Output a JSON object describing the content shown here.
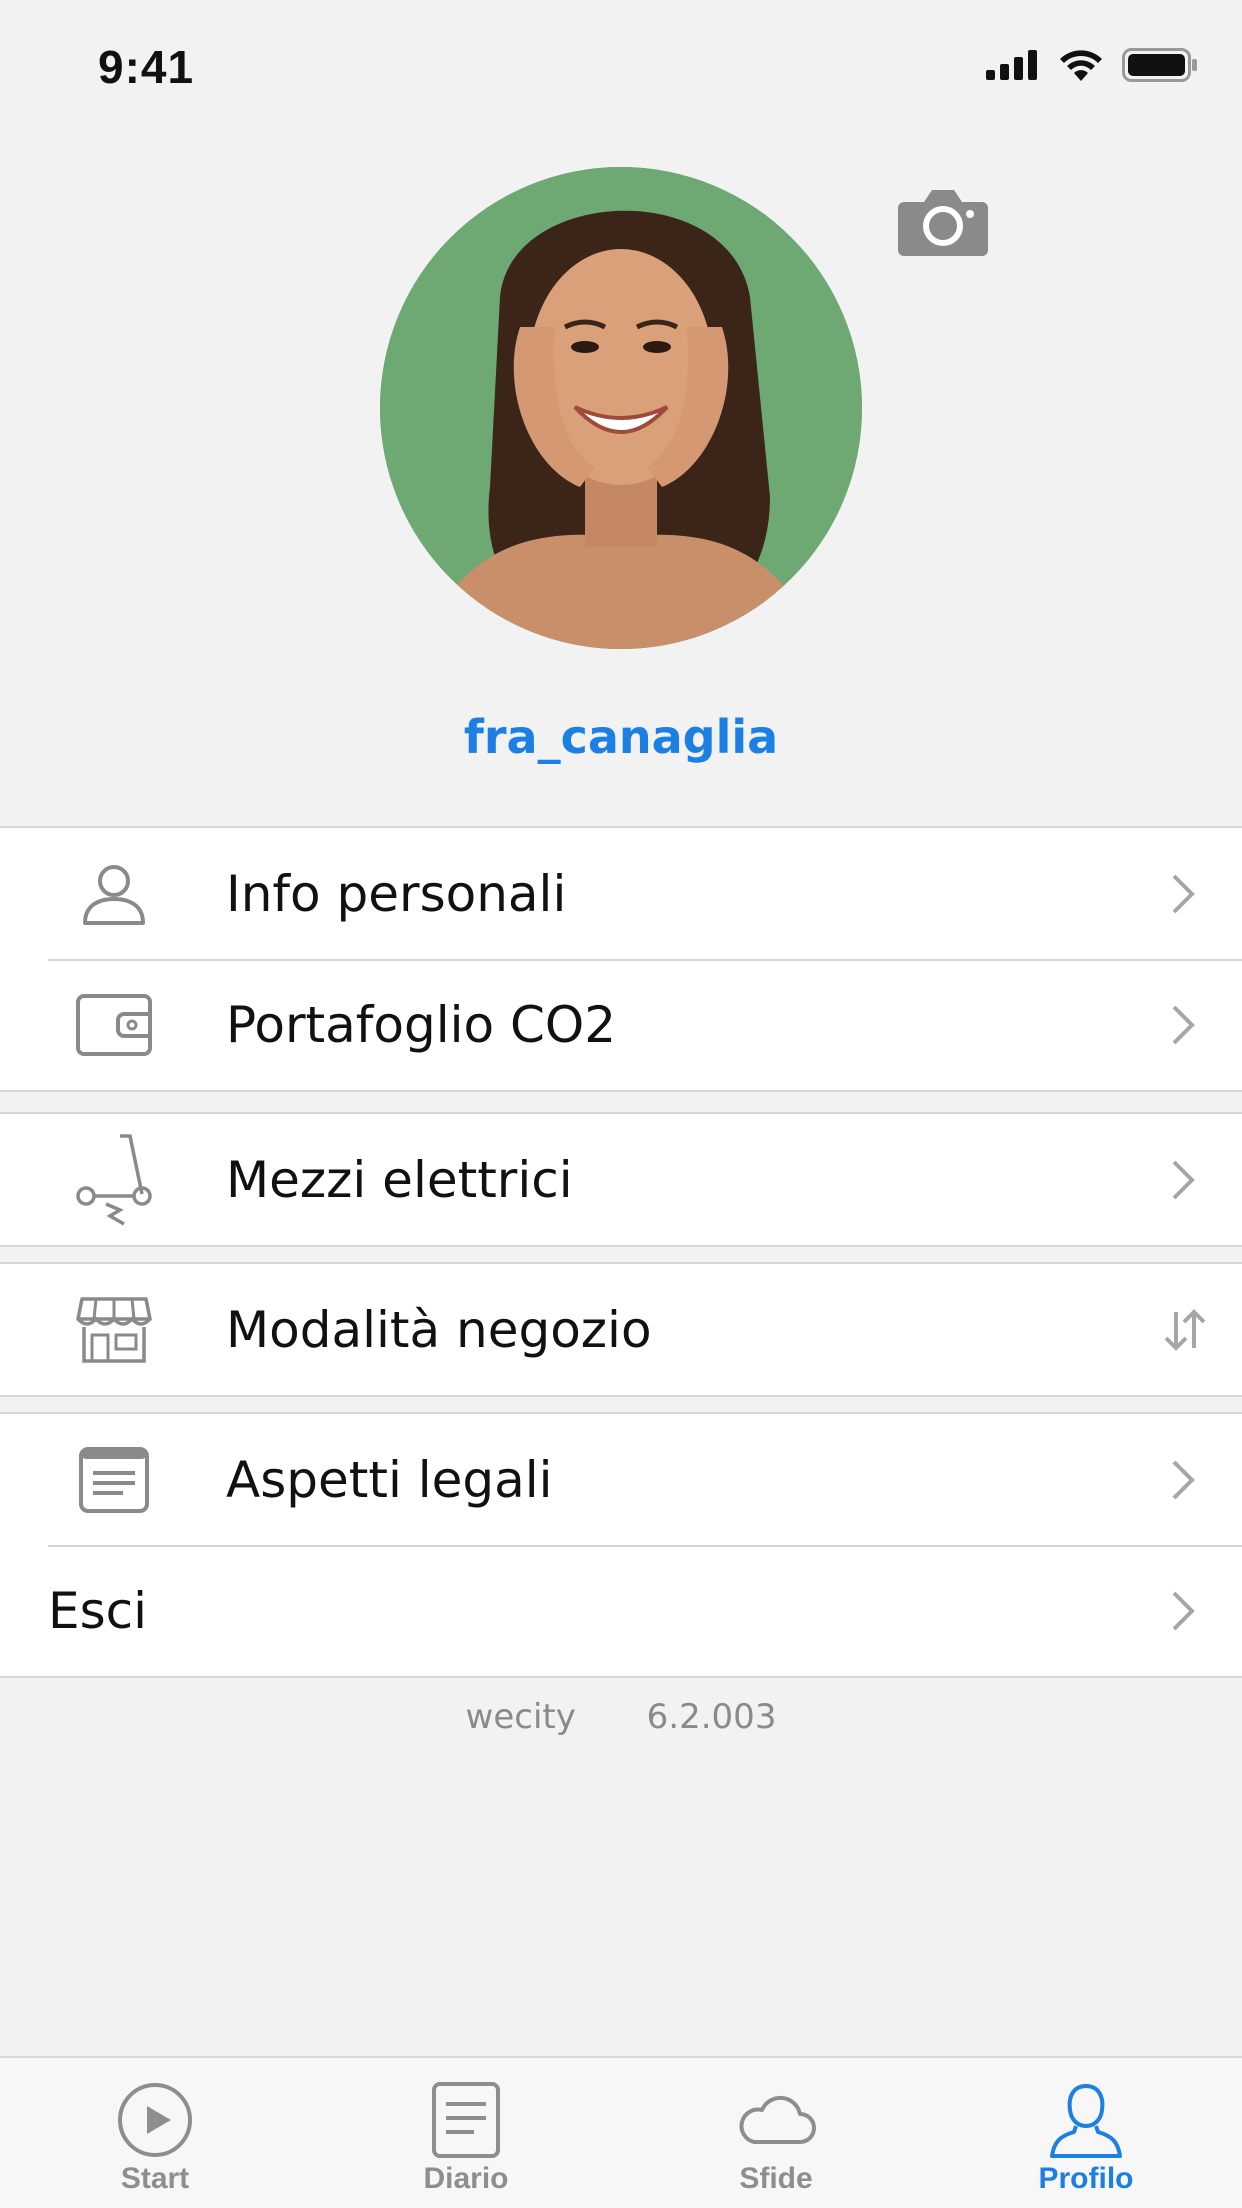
{
  "status_bar": {
    "time": "9:41"
  },
  "profile": {
    "username": "fra_canaglia"
  },
  "menu": {
    "info_personali": "Info personali",
    "portafoglio": "Portafoglio CO2",
    "mezzi_elettrici": "Mezzi elettrici",
    "modalita_negozio": "Modalità negozio",
    "aspetti_legali": "Aspetti legali",
    "esci": "Esci"
  },
  "footer": {
    "app_name": "wecity",
    "version": "6.2.003"
  },
  "tabbar": {
    "start": "Start",
    "diario": "Diario",
    "sfide": "Sfide",
    "profilo": "Profilo",
    "active": "profilo"
  },
  "colors": {
    "accent": "#1b7fe3",
    "icon_gray": "#8a8a8a",
    "background": "#f2f2f2"
  }
}
